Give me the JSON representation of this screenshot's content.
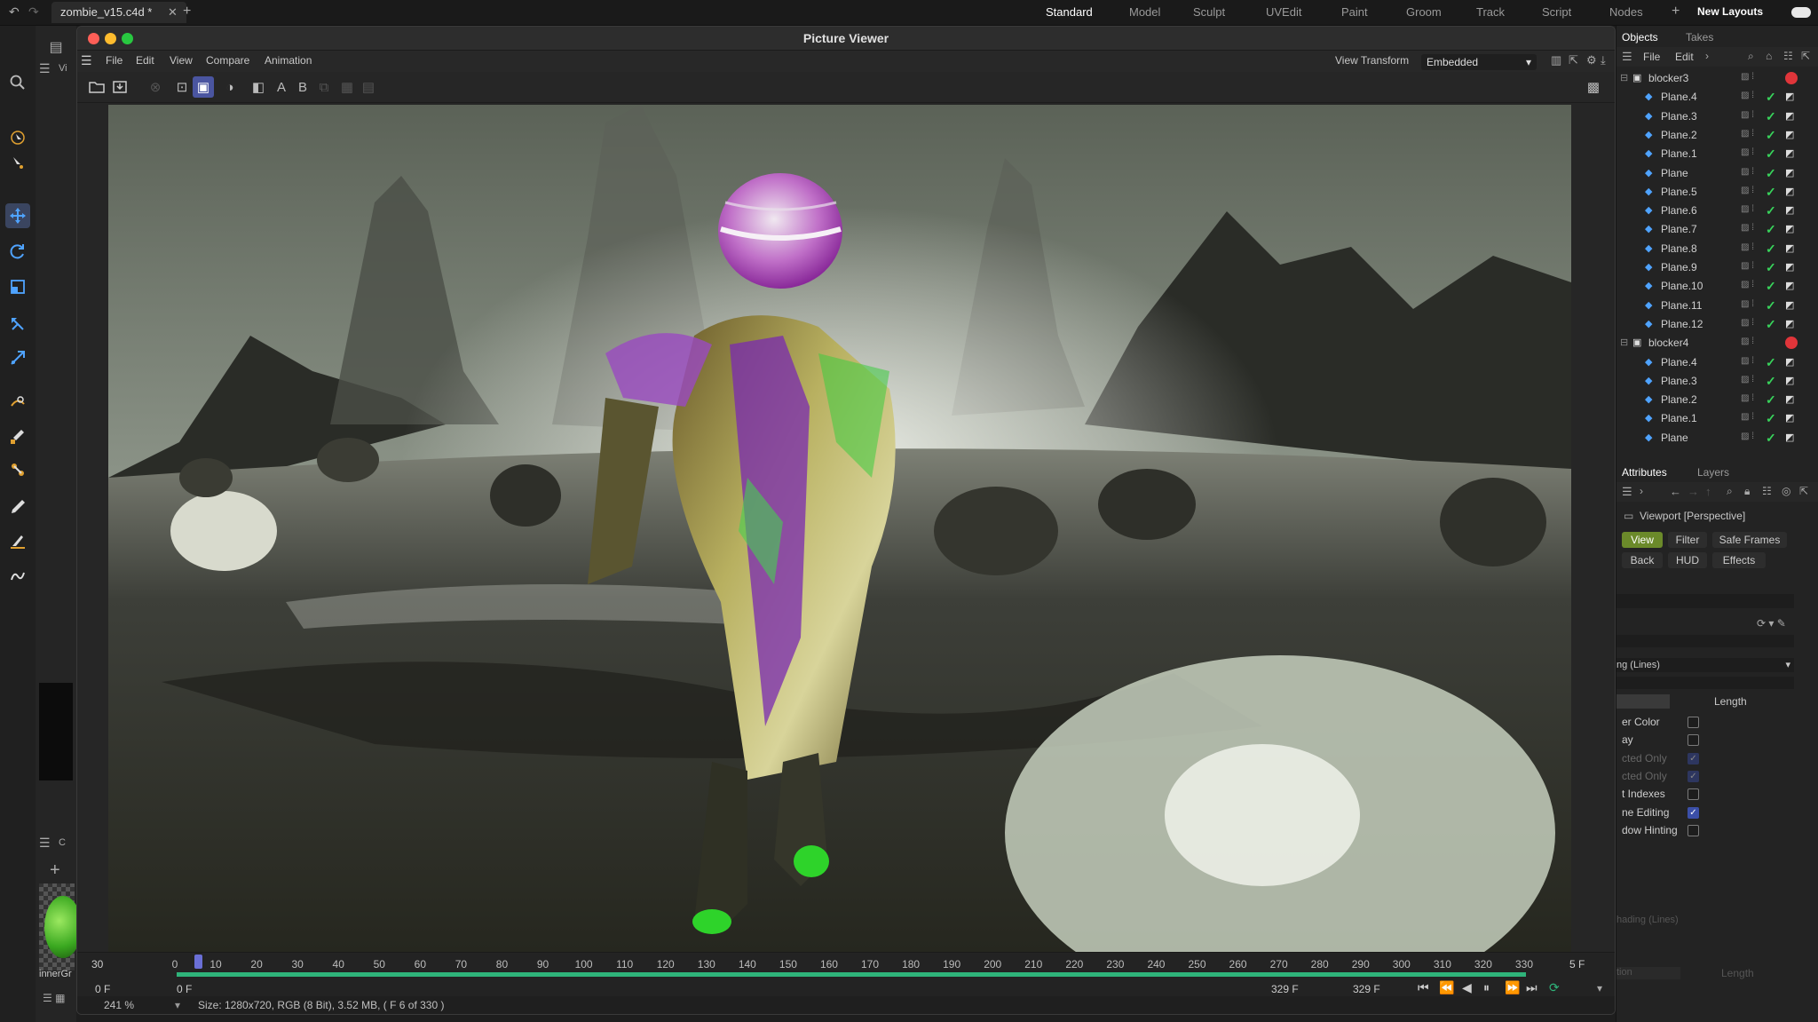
{
  "topbar": {
    "doc_tab": "zombie_v15.c4d *",
    "layouts": [
      "Standard",
      "Model",
      "Sculpt",
      "UVEdit",
      "Paint",
      "Groom",
      "Track",
      "Script",
      "Nodes"
    ],
    "new_layouts": "New Layouts"
  },
  "viewer": {
    "title": "Picture Viewer",
    "menu": [
      "File",
      "Edit",
      "View",
      "Compare",
      "Animation"
    ],
    "view_transform_label": "View Transform",
    "view_transform_value": "Embedded",
    "toolbar_a": "A",
    "toolbar_b": "B"
  },
  "timeline": {
    "ticks": [
      "0",
      "10",
      "20",
      "30",
      "40",
      "50",
      "60",
      "70",
      "80",
      "90",
      "100",
      "110",
      "120",
      "130",
      "140",
      "150",
      "160",
      "170",
      "180",
      "190",
      "200",
      "210",
      "220",
      "230",
      "240",
      "250",
      "260",
      "270",
      "280",
      "290",
      "300",
      "310",
      "320",
      "330"
    ],
    "left_top": "30",
    "left_bottom": "0 F",
    "start_field": "0 F",
    "current_a": "329 F",
    "current_b": "329 F",
    "right_top": "5 F",
    "progress": 1.0
  },
  "status": {
    "zoom": "241 %",
    "info": "Size: 1280x720, RGB (8 Bit), 3.52 MB,  ( F 6 of 330 )"
  },
  "left_panel": {
    "label1": "Vi",
    "label2": "C",
    "material": "innerGr"
  },
  "objects": {
    "tabs": [
      "Objects",
      "Takes"
    ],
    "menu": [
      "File",
      "Edit"
    ],
    "items": [
      {
        "name": "blocker3",
        "level": 0,
        "red": true
      },
      {
        "name": "Plane.4",
        "level": 1
      },
      {
        "name": "Plane.3",
        "level": 1
      },
      {
        "name": "Plane.2",
        "level": 1
      },
      {
        "name": "Plane.1",
        "level": 1
      },
      {
        "name": "Plane",
        "level": 1
      },
      {
        "name": "Plane.5",
        "level": 1
      },
      {
        "name": "Plane.6",
        "level": 1
      },
      {
        "name": "Plane.7",
        "level": 1
      },
      {
        "name": "Plane.8",
        "level": 1
      },
      {
        "name": "Plane.9",
        "level": 1
      },
      {
        "name": "Plane.10",
        "level": 1
      },
      {
        "name": "Plane.11",
        "level": 1
      },
      {
        "name": "Plane.12",
        "level": 1
      },
      {
        "name": "blocker4",
        "level": 0,
        "red": true
      },
      {
        "name": "Plane.4",
        "level": 1
      },
      {
        "name": "Plane.3",
        "level": 1
      },
      {
        "name": "Plane.2",
        "level": 1
      },
      {
        "name": "Plane.1",
        "level": 1
      },
      {
        "name": "Plane",
        "level": 1
      }
    ]
  },
  "attributes": {
    "tabs": [
      "Attributes",
      "Layers"
    ],
    "header": "Viewport [Perspective]",
    "buttons": [
      "View",
      "Filter",
      "Safe Frames",
      "Back",
      "HUD",
      "Effects"
    ],
    "dropdown": "ng (Lines)",
    "length_label": "Length",
    "rows": [
      {
        "label": "er Color",
        "checked": false,
        "dim": false
      },
      {
        "label": "ay",
        "checked": false,
        "dim": false
      },
      {
        "label": "cted Only",
        "checked": true,
        "dim": true
      },
      {
        "label": "cted Only",
        "checked": true,
        "dim": true
      },
      {
        "label": "t Indexes",
        "checked": false,
        "dim": false
      },
      {
        "label": "ne Editing",
        "checked": true,
        "dim": false
      },
      {
        "label": "dow Hinting",
        "checked": false,
        "dim": false
      }
    ],
    "footer_dropdown": "hading (Lines)",
    "footer_left": "tion",
    "footer_length": "Length"
  }
}
